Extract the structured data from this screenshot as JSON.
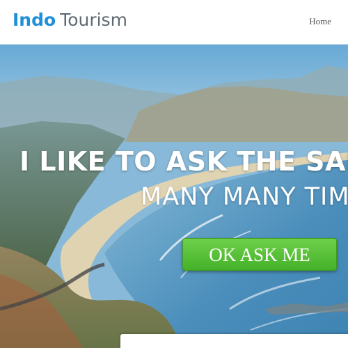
{
  "header": {
    "brand_accent": "Indo",
    "brand_rest": "Tourism",
    "nav": [
      {
        "label": "Home"
      }
    ]
  },
  "hero": {
    "headline": "I LIKE TO ASK THE SAME",
    "subline": "MANY MANY TIM",
    "cta_label": "OK ASK ME"
  },
  "colors": {
    "brand_accent": "#1e8fd8",
    "brand_text": "#5f6a72",
    "cta_green": "#4fbf32"
  }
}
